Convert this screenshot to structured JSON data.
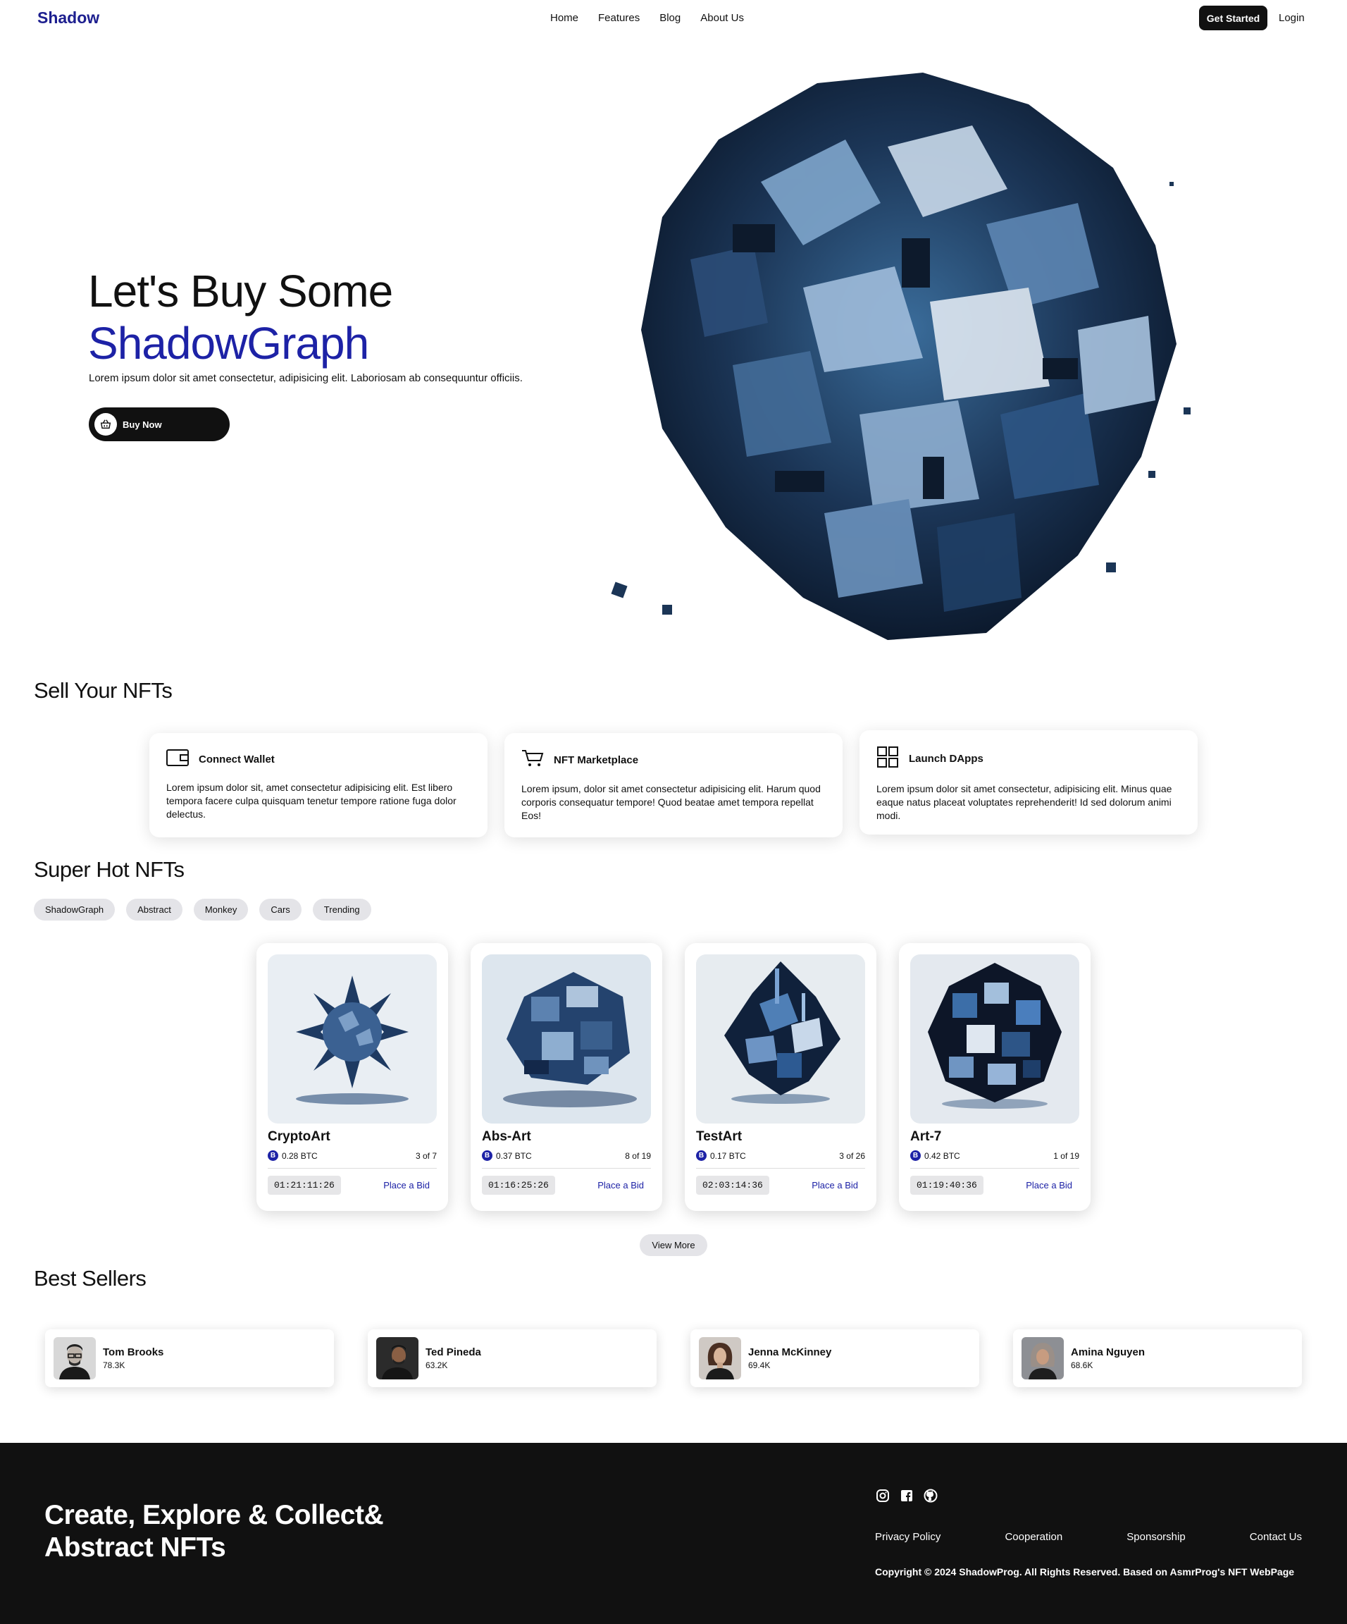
{
  "header": {
    "logo": "Shadow",
    "nav": [
      "Home",
      "Features",
      "Blog",
      "About Us"
    ],
    "get_started": "Get Started",
    "login": "Login"
  },
  "hero": {
    "title_line1": "Let's Buy Some",
    "title_line2": "ShadowGraph",
    "text": "Lorem ipsum dolor sit amet consectetur, adipisicing elit. Laboriosam ab consequuntur officiis.",
    "buy_button": "Buy Now"
  },
  "sell": {
    "title": "Sell Your NFTs",
    "cards": [
      {
        "title": "Connect Wallet",
        "icon": "wallet-icon",
        "text": "Lorem ipsum dolor sit, amet consectetur adipisicing elit. Est libero tempora facere culpa quisquam tenetur tempore ratione fuga dolor delectus."
      },
      {
        "title": "NFT Marketplace",
        "icon": "cart-icon",
        "text": "Lorem ipsum, dolor sit amet consectetur adipisicing elit. Harum quod corporis consequatur tempore! Quod beatae amet tempora repellat Eos!"
      },
      {
        "title": "Launch DApps",
        "icon": "grid-icon",
        "text": "Lorem ipsum dolor sit amet consectetur, adipisicing elit. Minus quae eaque natus placeat voluptates reprehenderit! Id sed dolorum animi modi."
      }
    ]
  },
  "hot": {
    "title": "Super Hot NFTs",
    "filters": [
      "ShadowGraph",
      "Abstract",
      "Monkey",
      "Cars",
      "Trending"
    ],
    "cards": [
      {
        "name": "CryptoArt",
        "price": "0.28 BTC",
        "count": "3 of 7",
        "timer": "01:21:11:26",
        "bid": "Place a Bid"
      },
      {
        "name": "Abs-Art",
        "price": "0.37 BTC",
        "count": "8 of 19",
        "timer": "01:16:25:26",
        "bid": "Place a Bid"
      },
      {
        "name": "TestArt",
        "price": "0.17 BTC",
        "count": "3 of 26",
        "timer": "02:03:14:36",
        "bid": "Place a Bid"
      },
      {
        "name": "Art-7",
        "price": "0.42 BTC",
        "count": "1 of 19",
        "timer": "01:19:40:36",
        "bid": "Place a Bid"
      }
    ],
    "view_more": "View More"
  },
  "sellers": {
    "title": "Best Sellers",
    "items": [
      {
        "name": "Tom Brooks",
        "count": "78.3K"
      },
      {
        "name": "Ted Pineda",
        "count": "63.2K"
      },
      {
        "name": "Jenna McKinney",
        "count": "69.4K"
      },
      {
        "name": "Amina Nguyen",
        "count": "68.6K"
      }
    ]
  },
  "footer": {
    "title_line1": "Create, Explore & Collect&",
    "title_line2": "Abstract NFTs",
    "socials": [
      "instagram-icon",
      "facebook-icon",
      "github-icon"
    ],
    "links": [
      "Privacy Policy",
      "Cooperation",
      "Sponsorship",
      "Contact Us"
    ],
    "copyright": "Copyright © 2024 ShadowProg. All Rights Reserved. Based on AsmrProg's NFT WebPage"
  },
  "colors": {
    "accent": "#1d22a6",
    "dark": "#111111",
    "pill": "#e4e4e8"
  }
}
